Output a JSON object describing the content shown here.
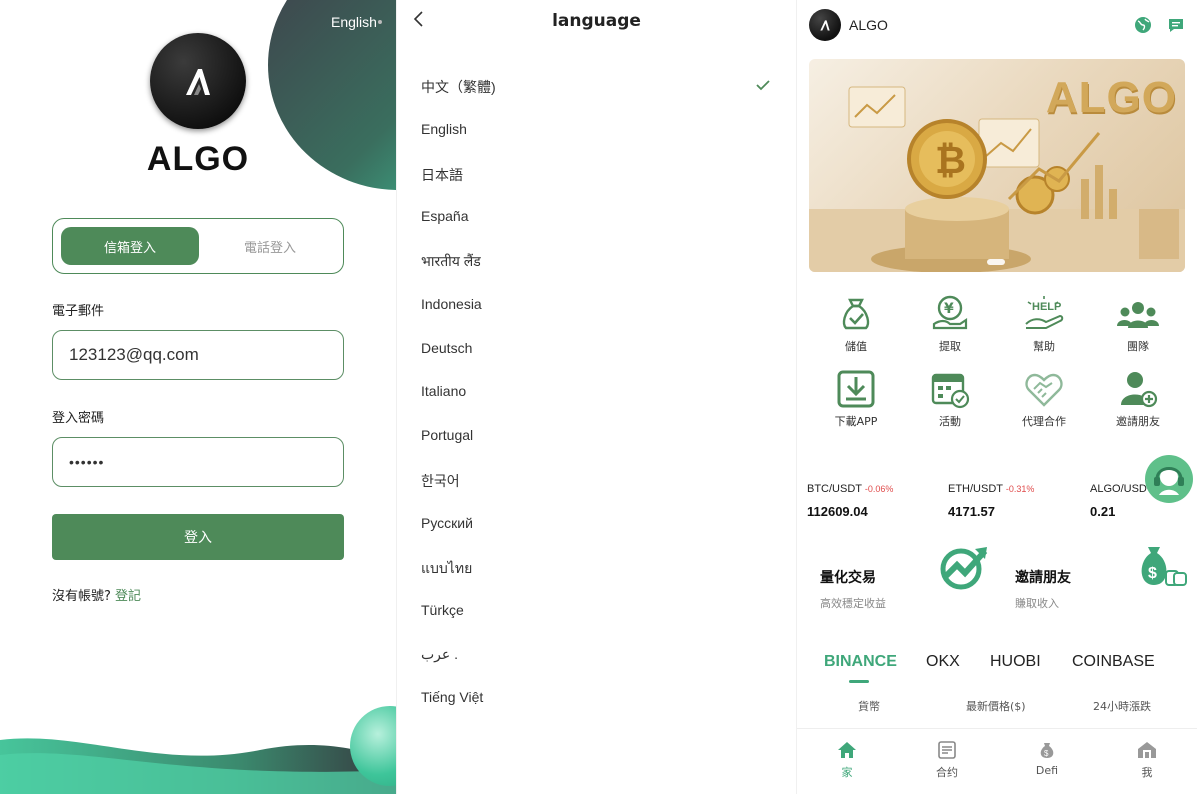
{
  "login": {
    "lang_switch": "English",
    "brand": "ALGO",
    "tabs": [
      "信箱登入",
      "電話登入"
    ],
    "email_label": "電子郵件",
    "email_value": "123123@qq.com",
    "password_label": "登入密碼",
    "password_value": "••••••",
    "submit": "登入",
    "no_account": "沒有帳號?",
    "register": "登記"
  },
  "language": {
    "title": "language",
    "items": [
      "中文（繁體)",
      "English",
      "日本語",
      "España",
      "भारतीय लैंड",
      "Indonesia",
      "Deutsch",
      "Italiano",
      "Portugal",
      "한국어",
      "Русский",
      "แบบไทย",
      "Türkçe",
      "عرب .",
      "Tiếng Việt"
    ],
    "selected_index": 0
  },
  "home": {
    "title": "ALGO",
    "banner_text": "ALGO",
    "icons_row1": [
      "儲值",
      "提取",
      "幫助",
      "團隊"
    ],
    "icons_row2": [
      "下載APP",
      "活動",
      "代理合作",
      "邀請朋友"
    ],
    "icon_names": [
      "money-bag-icon",
      "yen-withdraw-icon",
      "help-icon",
      "team-icon",
      "download-icon",
      "calendar-icon",
      "handshake-icon",
      "add-user-icon"
    ],
    "help_icon_text": "HELP",
    "tickers": [
      {
        "pair": "BTC/USDT",
        "change": "-0.06%",
        "price": "112609.04"
      },
      {
        "pair": "ETH/USDT",
        "change": "-0.31%",
        "price": "4171.57"
      },
      {
        "pair": "ALGO/USD",
        "change": "",
        "price": "0.21"
      }
    ],
    "promos": [
      {
        "title": "量化交易",
        "subtitle": "高效穩定收益"
      },
      {
        "title": "邀請朋友",
        "subtitle": "賺取收入"
      }
    ],
    "exchanges": [
      "BINANCE",
      "OKX",
      "HUOBI",
      "COINBASE"
    ],
    "columns": [
      "貨幣",
      "最新價格($)",
      "24小時漲跌"
    ],
    "tabbar": [
      "家",
      "合约",
      "Defi",
      "我"
    ],
    "accent": "#3fa77a",
    "negative": "#e04b4b"
  }
}
